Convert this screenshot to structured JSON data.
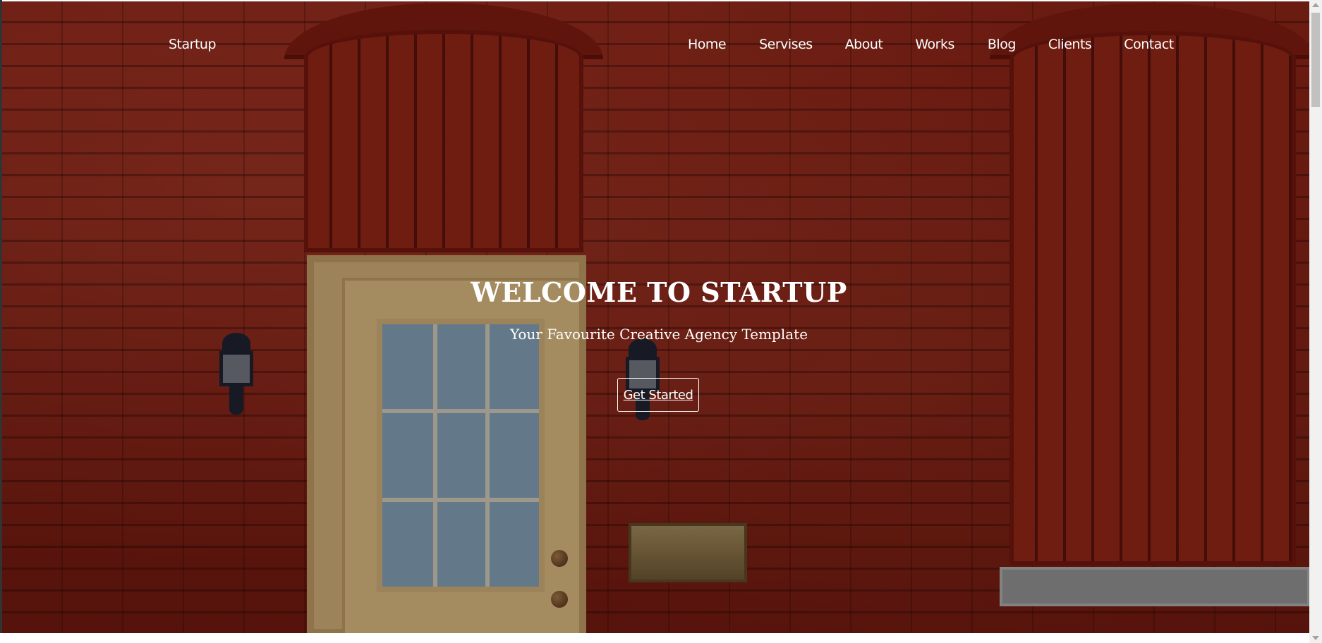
{
  "brand": "Startup",
  "nav": {
    "items": [
      {
        "label": "Home"
      },
      {
        "label": "Servises"
      },
      {
        "label": "About"
      },
      {
        "label": "Works"
      },
      {
        "label": "Blog"
      },
      {
        "label": "Clients"
      },
      {
        "label": "Contact"
      }
    ]
  },
  "hero": {
    "title": "WELCOME TO STARTUP",
    "subtitle": "Your Favourite Creative Agency Template",
    "cta_label": "Get Started"
  },
  "colors": {
    "hero_brick": "#7a1d12",
    "text": "#ffffff",
    "door": "#d3b27c",
    "scrollbar_track": "#f1f1f1",
    "scrollbar_thumb": "#c1c1c1"
  },
  "scroll": {
    "position": 0
  }
}
